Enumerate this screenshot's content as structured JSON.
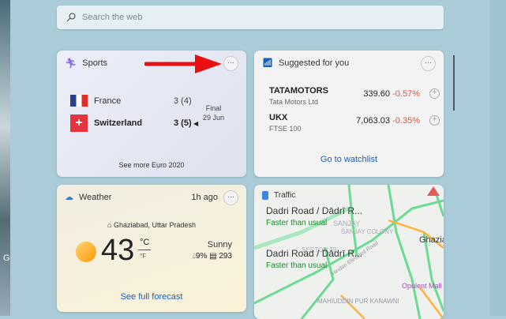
{
  "search": {
    "placeholder": "Search the web"
  },
  "desktop": {
    "edge_letter": "G"
  },
  "sports": {
    "title": "Sports",
    "teams": [
      {
        "name": "France",
        "score": "3 (4)"
      },
      {
        "name": "Switzerland",
        "score": "3 (5)"
      }
    ],
    "status": "Final",
    "date": "29 Jun",
    "link": "See more Euro 2020",
    "more": "···"
  },
  "stocks": {
    "title": "Suggested for you",
    "items": [
      {
        "symbol": "TATAMOTORS",
        "name": "Tata Motors Ltd",
        "price": "339.60",
        "change": "-0.57%"
      },
      {
        "symbol": "UKX",
        "name": "FTSE 100",
        "price": "7,063.03",
        "change": "-0.35%"
      }
    ],
    "link": "Go to watchlist",
    "more": "···",
    "add": "+"
  },
  "weather": {
    "title": "Weather",
    "updated": "1h ago",
    "location": "Ghaziabad, Uttar Pradesh",
    "temp": "43",
    "unit_c": "°C",
    "unit_f": "°F",
    "condition": "Sunny",
    "precip": "9%",
    "aqi": "293",
    "link": "See full forecast",
    "more": "···"
  },
  "traffic": {
    "title": "Traffic",
    "routes": [
      {
        "road": "Dadri Road / Dādrī R...",
        "status": "Faster than usual"
      },
      {
        "road": "Dadri Road / Dādrī R...",
        "status": "Faster than usual"
      }
    ],
    "map_labels": [
      "SANJAY COLONY",
      "SECTOR 19",
      "Hindan Elevated Road",
      "Ghazia",
      "Opulent Mall",
      "MAHIUDDIN PUR KANAWNI"
    ]
  }
}
